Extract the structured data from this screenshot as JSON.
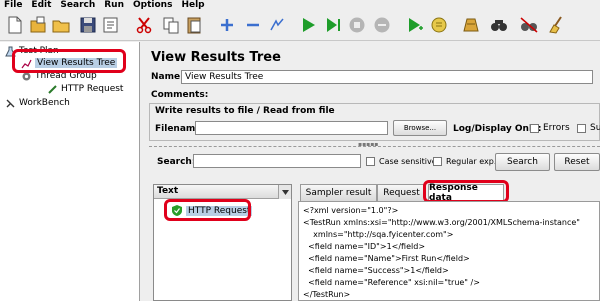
{
  "menu": [
    "File",
    "Edit",
    "Search",
    "Run",
    "Options",
    "Help"
  ],
  "toolbar": {
    "buttons": [
      "new-icon",
      "open-template-icon",
      "open-icon",
      "save-icon",
      "save-as-icon",
      "cut-icon",
      "copy-icon",
      "paste-icon",
      "expand-icon",
      "collapse-icon",
      "toggle-icon",
      "start-icon",
      "start-no-pause-icon",
      "stop-icon",
      "shutdown-icon",
      "remote-start-icon",
      "clear-icon",
      "clear-all-icon",
      "search-icon",
      "reset-search-icon",
      "broom-icon"
    ]
  },
  "tree": {
    "test_plan": "Test Plan",
    "view_results_tree": "View Results Tree",
    "thread_group": "Thread Group",
    "http_request": "HTTP Request",
    "workbench": "WorkBench"
  },
  "main": {
    "title": "View Results Tree",
    "name_label": "Name:",
    "name_value": "View Results Tree",
    "comments_label": "Comments:",
    "write_group_title": "Write results to file / Read from file",
    "filename_label": "Filename",
    "browse_label": "Browse...",
    "log_display_label": "Log/Display Only:",
    "errors_label": "Errors",
    "successes_label": "Su"
  },
  "search": {
    "label": "Search:",
    "value": "",
    "case_sensitive_label": "Case sensitive",
    "regular_exp_label": "Regular exp.",
    "search_button": "Search",
    "reset_button": "Reset"
  },
  "results": {
    "column_header": "Text",
    "items": [
      "HTTP Request"
    ],
    "tabs": [
      "Sampler result",
      "Request",
      "Response data"
    ],
    "active_tab": "Response data",
    "response_lines": [
      "<?xml version=\"1.0\"?>",
      "<TestRun xmlns:xsi=\"http://www.w3.org/2001/XMLSchema-instance\"",
      "    xmlns=\"http://sqa.fyicenter.com\">",
      "  <field name=\"ID\">1</field>",
      "  <field name=\"Name\">First Run</field>",
      "  <field name=\"Success\">1</field>",
      "  <field name=\"Reference\" xsi:nil=\"true\" />",
      "</TestRun>"
    ]
  },
  "colors": {
    "highlight": "#e0001b",
    "selection": "#b8cfe5",
    "success_green": "#2a9d2a"
  }
}
